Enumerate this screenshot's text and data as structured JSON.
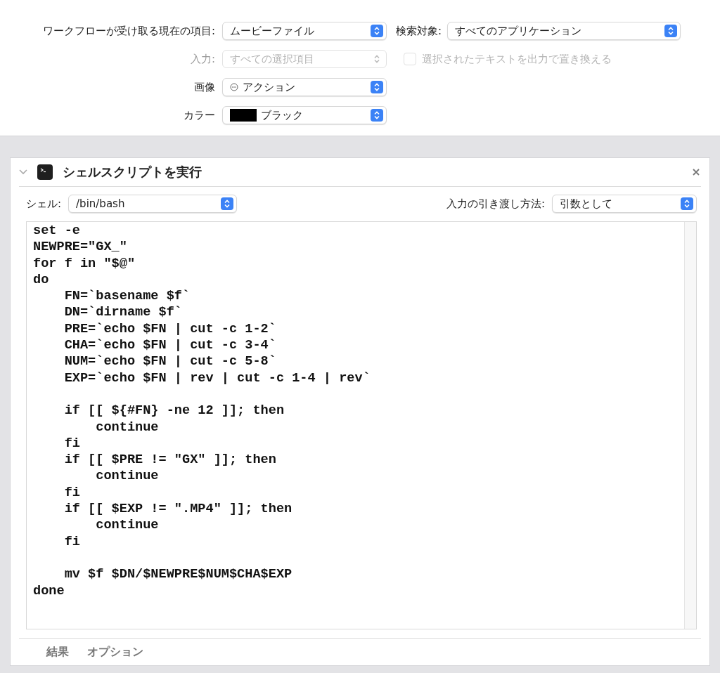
{
  "options": {
    "rows": [
      {
        "label": "ワークフローが受け取る現在の項目:",
        "popup": {
          "kind": "plain",
          "value": "ムービーファイル",
          "disabled": false
        },
        "extra": {
          "kind": "popup",
          "label": "検索対象:",
          "value": "すべてのアプリケーション"
        }
      },
      {
        "label": "入力:",
        "popup": {
          "kind": "plain",
          "value": "すべての選択項目",
          "disabled": true
        },
        "extra": {
          "kind": "checkbox",
          "label": "選択されたテキストを出力で置き換える",
          "checked": false,
          "disabled": true
        }
      },
      {
        "label": "画像",
        "popup": {
          "kind": "icon",
          "value": "アクション",
          "disabled": false
        }
      },
      {
        "label": "カラー",
        "popup": {
          "kind": "swatch",
          "value": "ブラック",
          "disabled": false,
          "color": "#000000"
        }
      }
    ]
  },
  "action": {
    "title": "シェルスクリプトを実行",
    "expanded": true,
    "shell_label": "シェル:",
    "shell": "/bin/bash",
    "pass_label": "入力の引き渡し方法:",
    "pass": "引数として",
    "script": "set -e\nNEWPRE=\"GX_\"\nfor f in \"$@\"\ndo\n    FN=`basename $f`\n    DN=`dirname $f`\n    PRE=`echo $FN | cut -c 1-2`\n    CHA=`echo $FN | cut -c 3-4`\n    NUM=`echo $FN | cut -c 5-8`\n    EXP=`echo $FN | rev | cut -c 1-4 | rev`\n\n    if [[ ${#FN} -ne 12 ]]; then\n        continue\n    fi\n    if [[ $PRE != \"GX\" ]]; then\n        continue\n    fi\n    if [[ $EXP != \".MP4\" ]]; then\n        continue\n    fi\n\n    mv $f $DN/$NEWPRE$NUM$CHA$EXP\ndone",
    "footer_tabs": [
      "結果",
      "オプション"
    ]
  }
}
